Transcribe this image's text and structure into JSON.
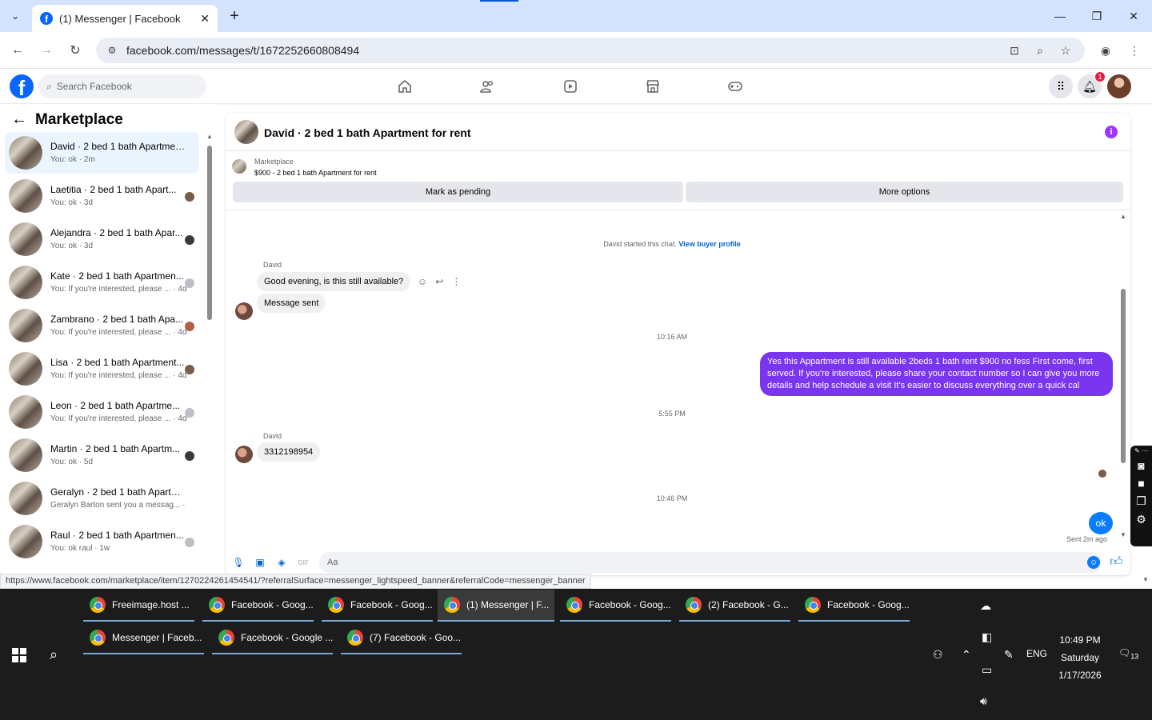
{
  "browser": {
    "tab_title": "(1) Messenger | Facebook",
    "url": "facebook.com/messages/t/1672252660808494",
    "status_url": "https://www.facebook.com/marketplace/item/1270224261454541/?referralSurface=messenger_lightspeed_banner&referralCode=messenger_banner"
  },
  "fb_header": {
    "search_placeholder": "Search Facebook",
    "notification_count": "1"
  },
  "sidebar": {
    "title": "Marketplace",
    "conversations": [
      {
        "name": "David · 2 bed 1 bath Apartment...",
        "snippet": "You: ok",
        "time": "2m",
        "active": true
      },
      {
        "name": "Laetitia · 2 bed 1 bath Apart...",
        "snippet": "You: ok",
        "time": "3d"
      },
      {
        "name": "Alejandra · 2 bed 1 bath Apar...",
        "snippet": "You: ok",
        "time": "3d"
      },
      {
        "name": "Kate · 2 bed 1 bath Apartmen...",
        "snippet": "You: If you're interested, please ...",
        "time": "4d"
      },
      {
        "name": "Zambrano · 2 bed 1 bath Apa...",
        "snippet": "You: If you're interested, please ...",
        "time": "4d"
      },
      {
        "name": "Lisa · 2 bed 1 bath Apartment...",
        "snippet": "You: If you're interested, please ...",
        "time": "4d"
      },
      {
        "name": "Leon · 2 bed 1 bath Apartme...",
        "snippet": "You: If you're interested, please ...",
        "time": "4d"
      },
      {
        "name": "Martin · 2 bed 1 bath Apartm...",
        "snippet": "You: ok",
        "time": "5d"
      },
      {
        "name": "Geralyn · 2 bed 1 bath Apartme...",
        "snippet": "Geralyn Barton sent you a messag...",
        "time": "1w"
      },
      {
        "name": "Raul · 2 bed 1 bath Apartmen...",
        "snippet": "You: ok raul",
        "time": "1w"
      }
    ]
  },
  "chat": {
    "title": "David · 2 bed 1 bath Apartment for rent",
    "listing_label": "Marketplace",
    "listing_desc": "$900 - 2 bed 1 bath Apartment for rent",
    "mark_pending": "Mark as pending",
    "more_options": "More options",
    "started_text": "David started this chat.",
    "view_buyer": "View buyer profile",
    "sender_name": "David",
    "msg1": "Good evening, is this still available?",
    "msg2": "Message sent",
    "time1": "10:16 AM",
    "outgoing": "Yes this Appartment is still available 2beds 1 bath rent $900 no fess First come, first served. If you're interested, please share your contact number so I can give you more details and help schedule a visit It's easier to discuss everything over a quick cal",
    "time2": "5:55 PM",
    "msg3": "3312198954",
    "time3": "10:46 PM",
    "ok_msg": "ok",
    "sent_note": "Sent 2m ago",
    "composer_placeholder": "Aa"
  },
  "taskbar": {
    "row1": [
      "Freeimage.host ...",
      "Facebook - Goog...",
      "Facebook - Goog...",
      "(1) Messenger | F...",
      "Facebook - Goog...",
      "(2) Facebook - G...",
      "Facebook - Goog..."
    ],
    "row2": [
      "Messenger | Faceb...",
      "Facebook - Google ...",
      "(7) Facebook - Goo..."
    ],
    "lang": "ENG",
    "time": "10:49 PM",
    "day": "Saturday",
    "date": "1/17/2026",
    "notifications": "13"
  }
}
